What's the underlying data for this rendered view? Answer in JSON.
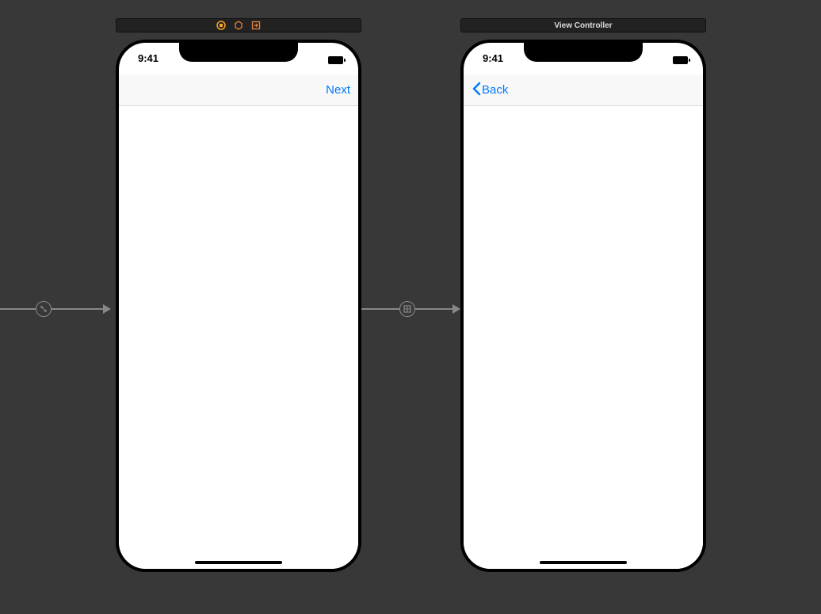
{
  "scenes": {
    "left": {
      "header_title": "",
      "status_time": "9:41",
      "nav_right_label": "Next"
    },
    "right": {
      "header_title": "View Controller",
      "status_time": "9:41",
      "nav_left_label": "Back"
    }
  }
}
